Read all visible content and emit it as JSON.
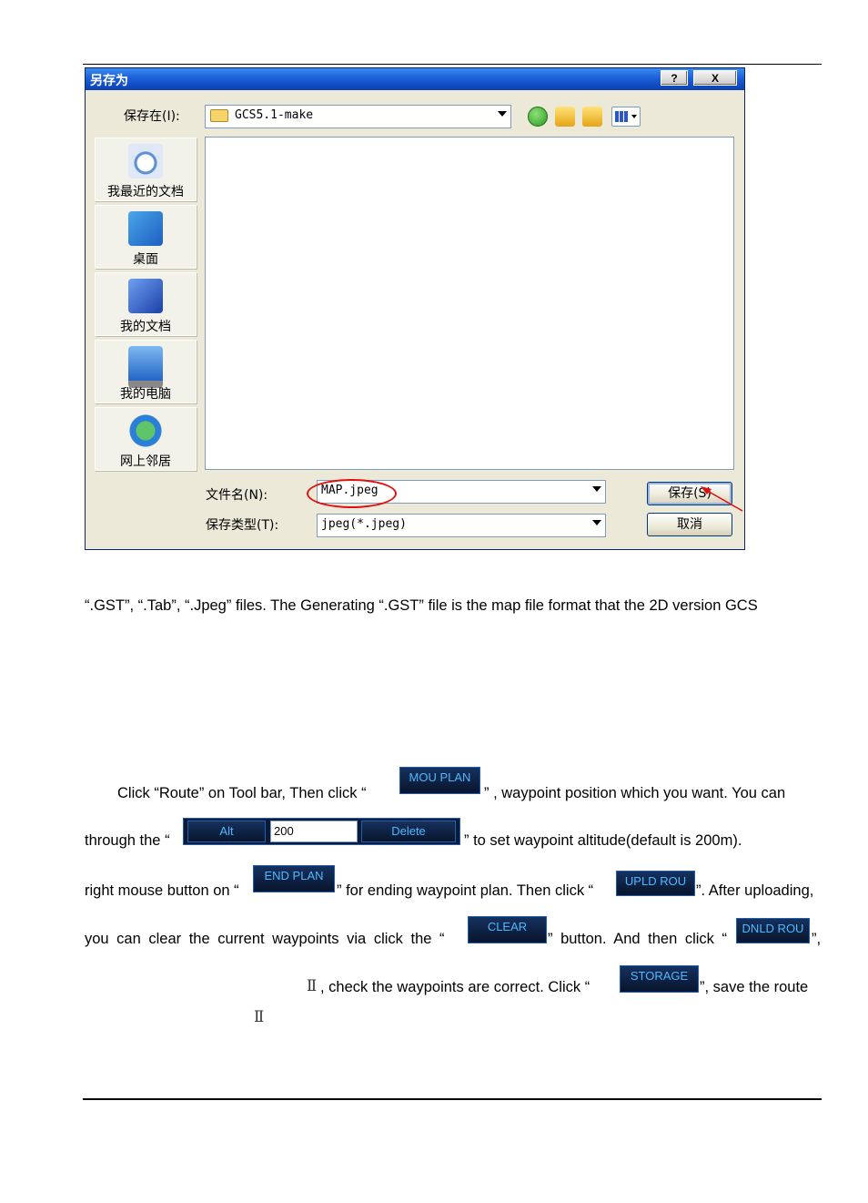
{
  "dialog": {
    "title": "另存为",
    "help_label": "?",
    "close_label": "X",
    "save_in_label": "保存在(I):",
    "folder_value": "GCS5.1-make",
    "places": [
      {
        "label": "我最近的文档",
        "icon": "recent-documents-icon"
      },
      {
        "label": "桌面",
        "icon": "desktop-icon"
      },
      {
        "label": "我的文档",
        "icon": "my-documents-icon"
      },
      {
        "label": "我的电脑",
        "icon": "my-computer-icon"
      },
      {
        "label": "网上邻居",
        "icon": "network-places-icon"
      }
    ],
    "filename_label": "文件名(N):",
    "filename_value": "MAP.jpeg",
    "filetype_label": "保存类型(T):",
    "filetype_value": "jpeg(*.jpeg)",
    "save_button": "保存(S)",
    "cancel_button": "取消",
    "colors": {
      "titlebar": "#1c5fd6",
      "annotation": "#e01010"
    }
  },
  "text": {
    "line1": "“.GST”, “.Tab”, “.Jpeg” files. The Generating “.GST” file is the map file format that the 2D version GCS",
    "p2_a": "Click “Route” on Tool bar, Then click “",
    "p2_b": "” , waypoint position which you want. You can",
    "p3_a": "through the “",
    "p3_b": "” to set waypoint altitude(default is 200m).",
    "p4_a": "right mouse button on “",
    "p4_b": "” for ending waypoint plan. Then click “",
    "p4_c": "”. After uploading,",
    "p5_a": "you can clear the current waypoints via click the “",
    "p5_b": "” button. And then click “",
    "p5_c": "”,",
    "p6_roman": "Ⅱ",
    "p6_a": ", check the waypoints are correct. Click “",
    "p6_b": "”, save the route",
    "p7_roman": "Ⅱ"
  },
  "gcs_buttons": {
    "mou_plan": "MOU PLAN",
    "alt_label": "Alt",
    "alt_value": "200",
    "delete": "Delete",
    "end_plan": "END PLAN",
    "upld_rou": "UPLD ROU",
    "clear": "CLEAR",
    "dnld_rou": "DNLD ROU",
    "storage": "STORAGE",
    "colors": {
      "background": "#0b1a36",
      "text": "#4fb8ff"
    }
  }
}
